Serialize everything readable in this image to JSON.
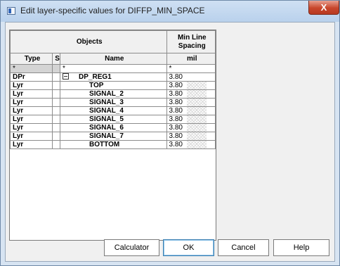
{
  "window": {
    "title": "Edit layer-specific values for DIFFP_MIN_SPACE",
    "close_label": "X"
  },
  "grid": {
    "header": {
      "objects": "Objects",
      "min_line_spacing": "Min Line Spacing",
      "type": "Type",
      "s": "S",
      "name": "Name",
      "unit": "mil"
    },
    "filter_row": {
      "type": "*",
      "name": "*",
      "value": "*"
    },
    "rows": [
      {
        "type": "DPr",
        "name": "DP_REG1",
        "value": "3.80"
      },
      {
        "type": "Lyr",
        "name": "TOP",
        "value": "3.80"
      },
      {
        "type": "Lyr",
        "name": "SIGNAL_2",
        "value": "3.80"
      },
      {
        "type": "Lyr",
        "name": "SIGNAL_3",
        "value": "3.80"
      },
      {
        "type": "Lyr",
        "name": "SIGNAL_4",
        "value": "3.80"
      },
      {
        "type": "Lyr",
        "name": "SIGNAL_5",
        "value": "3.80"
      },
      {
        "type": "Lyr",
        "name": "SIGNAL_6",
        "value": "3.80"
      },
      {
        "type": "Lyr",
        "name": "SIGNAL_7",
        "value": "3.80"
      },
      {
        "type": "Lyr",
        "name": "BOTTOM",
        "value": "3.80"
      }
    ]
  },
  "buttons": {
    "calculator": "Calculator",
    "ok": "OK",
    "cancel": "Cancel",
    "help": "Help"
  }
}
